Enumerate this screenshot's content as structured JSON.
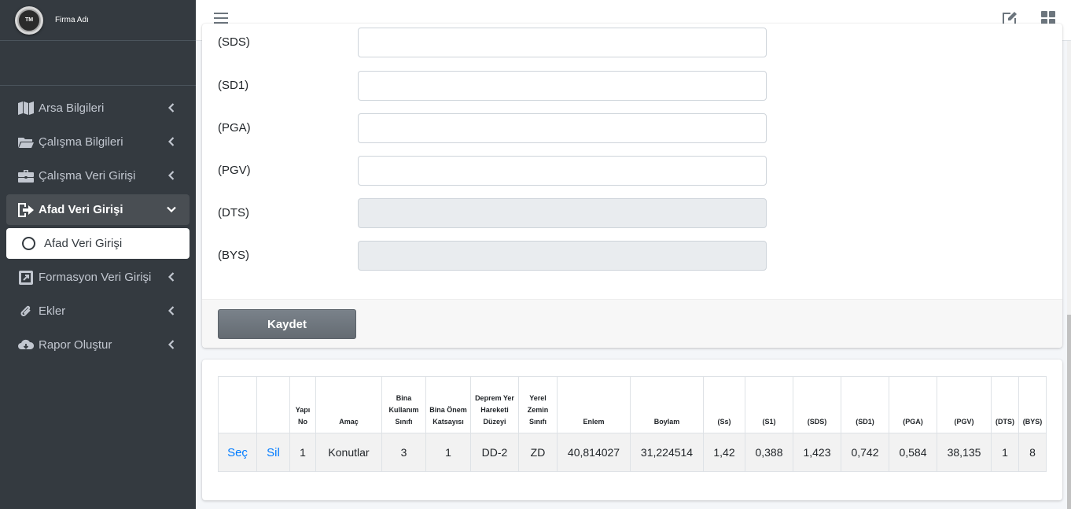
{
  "brand": {
    "logo_text": "TM",
    "name": "Firma Adı"
  },
  "sidebar": {
    "items": [
      {
        "label": "Arsa Bilgileri",
        "icon": "map-icon"
      },
      {
        "label": "Çalışma Bilgileri",
        "icon": "folder-open-icon"
      },
      {
        "label": "Çalışma Veri Girişi",
        "icon": "briefcase-icon"
      },
      {
        "label": "Afad Veri Girişi",
        "icon": "sign-out-icon",
        "open": true
      },
      {
        "label": "Formasyon Veri Girişi",
        "icon": "external-link-square-icon"
      },
      {
        "label": "Ekler",
        "icon": "paperclip-icon"
      },
      {
        "label": "Rapor Oluştur",
        "icon": "cloud-download-icon"
      }
    ],
    "subitem": {
      "label": "Afad Veri Girişi"
    }
  },
  "form": {
    "fields": [
      {
        "label": "(SDS)",
        "value": "",
        "disabled": false
      },
      {
        "label": "(SD1)",
        "value": "",
        "disabled": false
      },
      {
        "label": "(PGA)",
        "value": "",
        "disabled": false
      },
      {
        "label": "(PGV)",
        "value": "",
        "disabled": false
      },
      {
        "label": "(DTS)",
        "value": "",
        "disabled": true
      },
      {
        "label": "(BYS)",
        "value": "",
        "disabled": true
      }
    ],
    "save_label": "Kaydet"
  },
  "table": {
    "headers": [
      "",
      "",
      "Yapı No",
      "Amaç",
      "Bina Kullanım Sınıfı",
      "Bina Önem Katsayısı",
      "Deprem Yer Hareketi Düzeyi",
      "Yerel Zemin Sınıfı",
      "Enlem",
      "Boylam",
      "(Ss)",
      "(S1)",
      "(SDS)",
      "(SD1)",
      "(PGA)",
      "(PGV)",
      "(DTS)",
      "(BYS)"
    ],
    "rows": [
      [
        "Seç",
        "Sil",
        "1",
        "Konutlar",
        "3",
        "1",
        "DD-2",
        "ZD",
        "40,814027",
        "31,224514",
        "1,42",
        "0,388",
        "1,423",
        "0,742",
        "0,584",
        "38,135",
        "1",
        "8"
      ]
    ]
  },
  "colors": {
    "sidebar_bg": "#343a40",
    "link": "#007bff",
    "button": "#6c757d"
  }
}
